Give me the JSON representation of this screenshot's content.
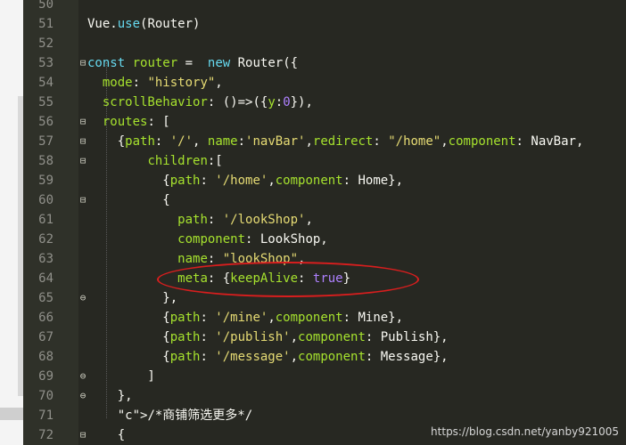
{
  "watermark": "https://blog.csdn.net/yanby921005",
  "lines": [
    {
      "no": "50",
      "fold": "",
      "code": ""
    },
    {
      "no": "51",
      "fold": "",
      "code": "Vue.use(Router)"
    },
    {
      "no": "52",
      "fold": "",
      "code": ""
    },
    {
      "no": "53",
      "fold": "⊟",
      "code": "const router =  new Router({"
    },
    {
      "no": "54",
      "fold": "",
      "code": "  mode: \"history\","
    },
    {
      "no": "55",
      "fold": "",
      "code": "  scrollBehavior: ()=>({y:0}),"
    },
    {
      "no": "56",
      "fold": "⊟",
      "code": "  routes: ["
    },
    {
      "no": "57",
      "fold": "⊟",
      "code": "    {path: '/', name:'navBar',redirect: \"/home\",component: NavBar,"
    },
    {
      "no": "58",
      "fold": "⊟",
      "code": "        children:["
    },
    {
      "no": "59",
      "fold": "",
      "code": "          {path: '/home',component: Home},"
    },
    {
      "no": "60",
      "fold": "⊟",
      "code": "          {"
    },
    {
      "no": "61",
      "fold": "",
      "code": "            path: '/lookShop',"
    },
    {
      "no": "62",
      "fold": "",
      "code": "            component: LookShop,"
    },
    {
      "no": "63",
      "fold": "",
      "code": "            name: \"lookShop\","
    },
    {
      "no": "64",
      "fold": "",
      "code": "            meta: {keepAlive: true}"
    },
    {
      "no": "65",
      "fold": "⊖",
      "code": "          },"
    },
    {
      "no": "66",
      "fold": "",
      "code": "          {path: '/mine',component: Mine},"
    },
    {
      "no": "67",
      "fold": "",
      "code": "          {path: '/publish',component: Publish},"
    },
    {
      "no": "68",
      "fold": "",
      "code": "          {path: '/message',component: Message},"
    },
    {
      "no": "69",
      "fold": "⊖",
      "code": "        ]"
    },
    {
      "no": "70",
      "fold": "⊖",
      "code": "    },"
    },
    {
      "no": "71",
      "fold": "",
      "code": "    /*商铺筛选更多*/"
    },
    {
      "no": "72",
      "fold": "⊟",
      "code": "    {"
    }
  ]
}
